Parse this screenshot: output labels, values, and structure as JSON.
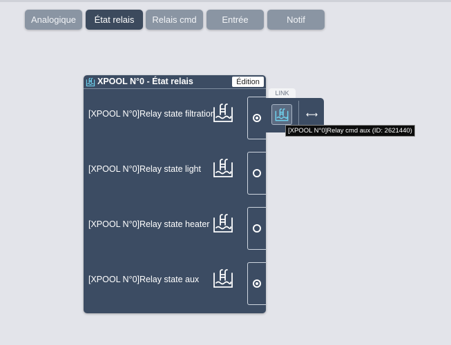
{
  "tabs": [
    {
      "label": "Analogique",
      "active": false
    },
    {
      "label": "État relais",
      "active": true
    },
    {
      "label": "Relais cmd",
      "active": false
    },
    {
      "label": "Entrée",
      "active": false
    },
    {
      "label": "Notif",
      "active": false
    }
  ],
  "panel": {
    "icon": "pool-icon",
    "title": "XPOOL N°0 - État relais",
    "edit_label": "Édition",
    "rows": [
      {
        "label": "[XPOOL N°0]Relay state filtration",
        "icon": "pool-icon",
        "selected": true
      },
      {
        "label": "[XPOOL N°0]Relay state light",
        "icon": "pool-icon",
        "selected": false
      },
      {
        "label": "[XPOOL N°0]Relay state heater",
        "icon": "pool-icon",
        "selected": false
      },
      {
        "label": "[XPOOL N°0]Relay state aux",
        "icon": "pool-icon",
        "selected": true
      }
    ]
  },
  "link": {
    "tab_label": "LINK",
    "icon": "pool-icon",
    "arrow": "⟷",
    "tooltip": "[XPOOL N°0]Relay cmd aux (ID: 2621440)"
  },
  "colors": {
    "panel_bg": "#3c4c63",
    "tab_bg": "#8a95a3",
    "tab_active_bg": "#3c4a5d",
    "page_bg": "#e3e4ea",
    "link_icon_color": "#6fd3f0"
  }
}
